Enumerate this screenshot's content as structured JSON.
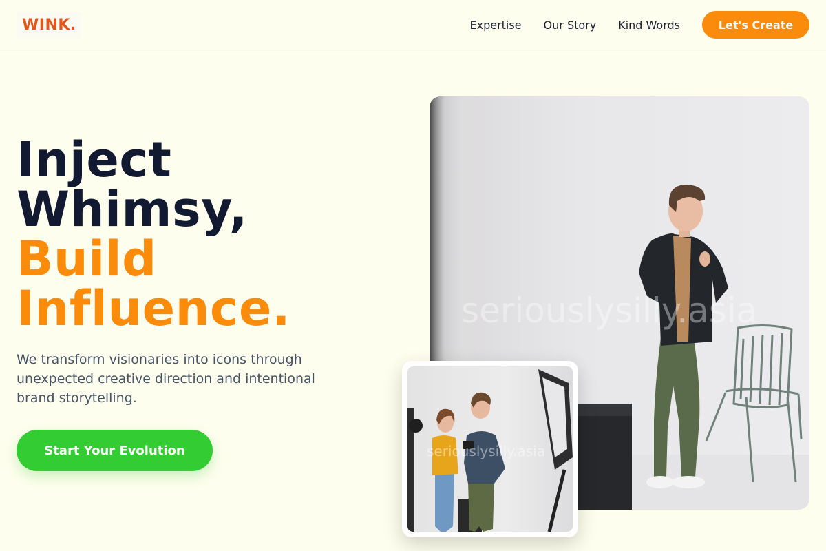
{
  "header": {
    "logo": "WINK.",
    "nav": [
      "Expertise",
      "Our Story",
      "Kind Words"
    ],
    "cta": "Let's Create"
  },
  "hero": {
    "title_line1": "Inject",
    "title_line2": "Whimsy,",
    "title_line3": "Build",
    "title_line4": "Influence.",
    "subtitle": "We transform visionaries into icons through unexpected creative direction and intentional brand storytelling.",
    "button": "Start Your Evolution"
  },
  "images": {
    "main_watermark": "seriouslysilly.asia",
    "small_watermark": "seriouslysilly.asia"
  },
  "colors": {
    "background": "#fefeee",
    "accent_orange": "#fb8b0b",
    "logo_orange": "#e2561c",
    "primary_green": "#33cc33",
    "heading_dark": "#111a30"
  }
}
